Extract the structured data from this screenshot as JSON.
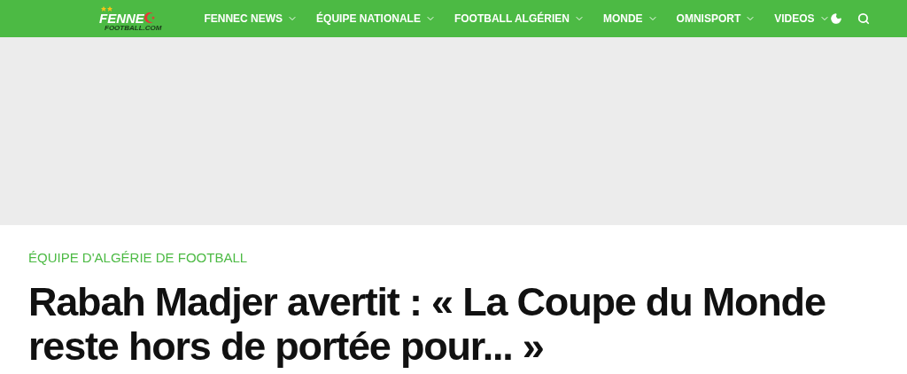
{
  "logo": {
    "text": "FENNE",
    "subtext": "FOOTBALL.COM"
  },
  "nav": [
    {
      "label": "FENNEC NEWS"
    },
    {
      "label": "ÉQUIPE NATIONALE"
    },
    {
      "label": "FOOTBALL ALGÉRIEN"
    },
    {
      "label": "MONDE"
    },
    {
      "label": "OMNISPORT"
    },
    {
      "label": "VIDEOS"
    }
  ],
  "article": {
    "category": "ÉQUIPE D'ALGÉRIE DE FOOTBALL",
    "title": "Rabah Madjer avertit : « La Coupe du Monde reste hors de portée pour... »"
  }
}
